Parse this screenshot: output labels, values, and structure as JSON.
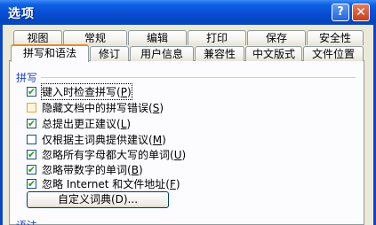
{
  "window": {
    "title": "选项",
    "help_glyph": "?",
    "close_glyph": "✕"
  },
  "tabs_row1": [
    "视图",
    "常规",
    "编辑",
    "打印",
    "保存",
    "安全性"
  ],
  "tabs_row2": [
    "拼写和语法",
    "修订",
    "用户信息",
    "兼容性",
    "中文版式",
    "文件位置"
  ],
  "active_tab": "拼写和语法",
  "spelling": {
    "group_label": "拼写",
    "options": [
      {
        "label": "键入时检查拼写",
        "accel": "P",
        "checked": true,
        "focused": true
      },
      {
        "label": "隐藏文档中的拼写错误",
        "accel": "S",
        "checked": false
      },
      {
        "label": "总提出更正建议",
        "accel": "L",
        "checked": true
      },
      {
        "label": "仅根据主词典提供建议",
        "accel": "M",
        "checked": false
      },
      {
        "label": "忽略所有字母都大写的单词",
        "accel": "U",
        "checked": true
      },
      {
        "label": "忽略带数字的单词",
        "accel": "B",
        "checked": true
      },
      {
        "label": "忽略 Internet 和文件地址",
        "accel": "F",
        "checked": true
      }
    ],
    "dict_button": "自定义词典(D)...",
    "next_group_label": "语法"
  }
}
